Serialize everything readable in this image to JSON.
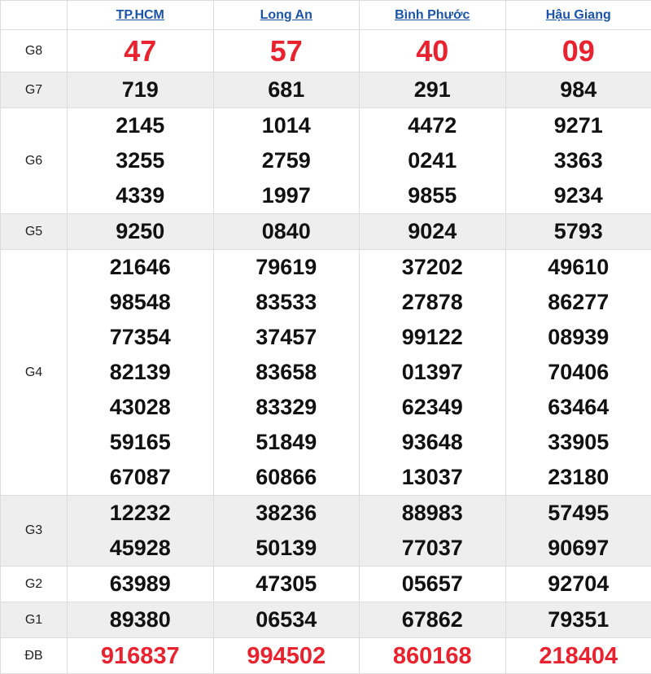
{
  "provinces": [
    "TP.HCM",
    "Long An",
    "Bình Phước",
    "Hậu Giang"
  ],
  "colors": {
    "link": "#1a54a6",
    "red": "#e8232f",
    "shade": "#eeeeee"
  },
  "prizes": [
    {
      "label": "G8",
      "shade": false,
      "style": "big",
      "values": [
        [
          "47"
        ],
        [
          "57"
        ],
        [
          "40"
        ],
        [
          "09"
        ]
      ]
    },
    {
      "label": "G7",
      "shade": true,
      "style": "num",
      "values": [
        [
          "719"
        ],
        [
          "681"
        ],
        [
          "291"
        ],
        [
          "984"
        ]
      ]
    },
    {
      "label": "G6",
      "shade": false,
      "style": "num",
      "values": [
        [
          "2145",
          "3255",
          "4339"
        ],
        [
          "1014",
          "2759",
          "1997"
        ],
        [
          "4472",
          "0241",
          "9855"
        ],
        [
          "9271",
          "3363",
          "9234"
        ]
      ]
    },
    {
      "label": "G5",
      "shade": true,
      "style": "num",
      "values": [
        [
          "9250"
        ],
        [
          "0840"
        ],
        [
          "9024"
        ],
        [
          "5793"
        ]
      ]
    },
    {
      "label": "G4",
      "shade": false,
      "style": "num",
      "values": [
        [
          "21646",
          "98548",
          "77354",
          "82139",
          "43028",
          "59165",
          "67087"
        ],
        [
          "79619",
          "83533",
          "37457",
          "83658",
          "83329",
          "51849",
          "60866"
        ],
        [
          "37202",
          "27878",
          "99122",
          "01397",
          "62349",
          "93648",
          "13037"
        ],
        [
          "49610",
          "86277",
          "08939",
          "70406",
          "63464",
          "33905",
          "23180"
        ]
      ]
    },
    {
      "label": "G3",
      "shade": true,
      "style": "num",
      "values": [
        [
          "12232",
          "45928"
        ],
        [
          "38236",
          "50139"
        ],
        [
          "88983",
          "77037"
        ],
        [
          "57495",
          "90697"
        ]
      ]
    },
    {
      "label": "G2",
      "shade": false,
      "style": "num",
      "values": [
        [
          "63989"
        ],
        [
          "47305"
        ],
        [
          "05657"
        ],
        [
          "92704"
        ]
      ]
    },
    {
      "label": "G1",
      "shade": true,
      "style": "num",
      "values": [
        [
          "89380"
        ],
        [
          "06534"
        ],
        [
          "67862"
        ],
        [
          "79351"
        ]
      ]
    },
    {
      "label": "ĐB",
      "shade": false,
      "style": "red",
      "values": [
        [
          "916837"
        ],
        [
          "994502"
        ],
        [
          "860168"
        ],
        [
          "218404"
        ]
      ]
    }
  ]
}
